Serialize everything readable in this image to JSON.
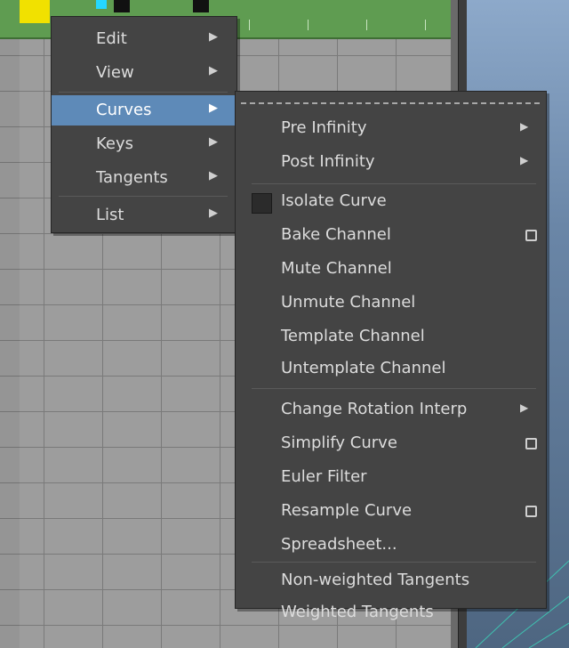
{
  "main_menu": {
    "items": [
      {
        "label": "Edit",
        "has_submenu": true,
        "active": false
      },
      {
        "label": "View",
        "has_submenu": true,
        "active": false
      },
      {
        "label": "Curves",
        "has_submenu": true,
        "active": true
      },
      {
        "label": "Keys",
        "has_submenu": true,
        "active": false
      },
      {
        "label": "Tangents",
        "has_submenu": true,
        "active": false
      },
      {
        "label": "List",
        "has_submenu": true,
        "active": false
      }
    ]
  },
  "curves_submenu": {
    "tear_off": true,
    "items": [
      {
        "label": "Pre Infinity",
        "suffix": "arrow"
      },
      {
        "label": "Post Infinity",
        "suffix": "arrow"
      },
      {
        "label": "Isolate Curve",
        "prefix": "checkbox",
        "checked": false
      },
      {
        "label": "Bake Channel",
        "suffix": "option-box"
      },
      {
        "label": "Mute Channel"
      },
      {
        "label": "Unmute Channel"
      },
      {
        "label": "Template Channel"
      },
      {
        "label": "Untemplate Channel"
      },
      {
        "label": "Change Rotation Interp",
        "suffix": "arrow"
      },
      {
        "label": "Simplify Curve",
        "suffix": "option-box"
      },
      {
        "label": "Euler Filter"
      },
      {
        "label": "Resample Curve",
        "suffix": "option-box"
      },
      {
        "label": "Spreadsheet..."
      },
      {
        "label": "Non-weighted Tangents"
      },
      {
        "label": "Weighted Tangents"
      }
    ]
  },
  "colors": {
    "menu_background": "#444444",
    "highlight": "#5e8ab8",
    "graph_background": "#9d9d9d",
    "timebar": "#5f9c51",
    "key_yellow": "#f1e100",
    "key_cyan": "#25d7ff"
  },
  "icons": [
    "submenu-arrow-icon",
    "option-box-icon",
    "checkbox-icon"
  ]
}
